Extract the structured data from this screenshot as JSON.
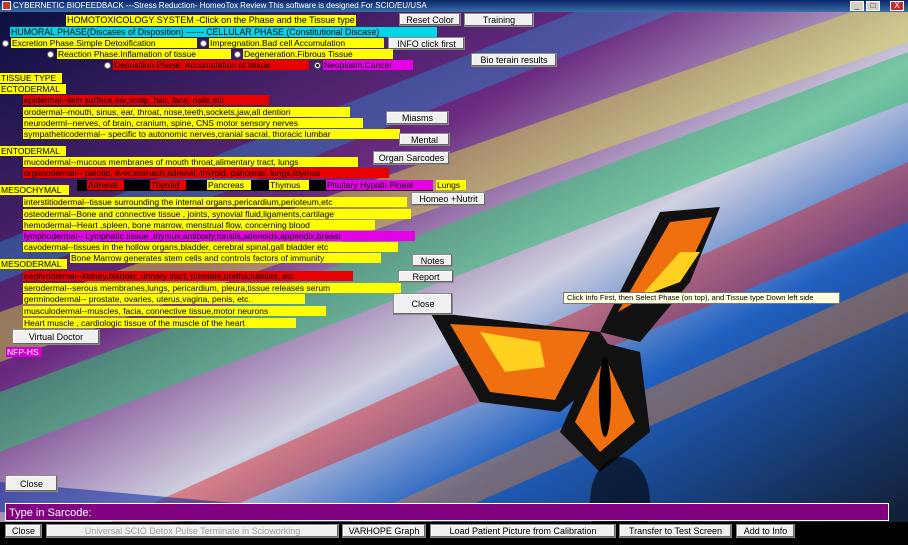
{
  "window": {
    "title": "CYBERNETIC BIOFEEDBACK    ---Stress Reduction-    HomeoTox Review    This software is designed For SCIO/EU/USA",
    "controls": [
      "_",
      "□",
      "X"
    ]
  },
  "header": {
    "system_title": "HOMOTOXICOLOGY SYSTEM  -Click on the Phase and the Tissue type",
    "reset_label": "Reset Color",
    "training_label": "Training",
    "phase_header": "HUMORAL PHASE(Discases of Disposition) ------ CELLULAR PHASE (Constitutional Discase)",
    "info_label": "INFO click first",
    "bio_terrain_label": "Bio terain results"
  },
  "phases": [
    {
      "label": "Excretion Phase.Simple Detoxification",
      "selected": false
    },
    {
      "label": "Impregnation.Bad cell Accumulation",
      "selected": false
    },
    {
      "label": "Reaction Phase.Inflamation of tissue",
      "selected": false
    },
    {
      "label": "Degeneration.Fibrous Tissue",
      "selected": false
    },
    {
      "label": "Deposition Phase. Accumulation of tissue",
      "selected": false
    },
    {
      "label": "Neoplasm.Cancer",
      "selected": true
    }
  ],
  "tissue": {
    "title": "TISSUE TYPE",
    "ectodermal": {
      "header": "ECTODERMAL",
      "items": [
        "epidermal--skin surface,ear,scalp, hair, face, nails,etc",
        "orodermal--mouth, sinus, ear, throat, nose,teeth,sockets,jaw,all dention",
        "neuroderml--nerves, of brain, cranium, spine, CNS motor sensory nerves",
        "sympatheticodermal-- specific to autonomic nerves,cranial sacral, thoracic lumbar"
      ]
    },
    "entodermal": {
      "header": "ENTODERMAL",
      "items": [
        "mucodermal--mucous membranes of mouth throat,alimentary tract, lungs",
        "organodermal-- parotid, liver,stomach,adrenal, thyroid, pancreas, lungs,thymus"
      ]
    },
    "organs": [
      "Adrenal",
      "Thyroid",
      "Pancreas",
      "Thymus",
      "Pituitary Hypoth Pineal",
      "Lungs"
    ],
    "mesochymal": {
      "header": "MESOCHYMAL",
      "items": [
        "interstitiodermal--tissue surrounding the internal organs,pericardium,perioteum,etc",
        "osteodermal--Bone and connective tissue , joints, synovial fluid,ligaments,cartilage",
        "hemodermal--Heart ,spleen, bone marrow, menstrual flow, concerning blood",
        "lymphodermal-- Lymphatic tissue ,thymus,antibody,tonsils,adenoids,appendix,breast",
        "cavodermal--tissues in the hollow organs,bladder, cerebral spinal,gall bladder etc",
        "Bone Marrow generates stem cells and controls factors of immunity"
      ]
    },
    "mesodermal": {
      "header": "MESODERMAL",
      "items": [
        "nephrodermal--kidney,bladder, urinary tract, prostate,uretha,tubules, etc",
        "serodermal--serous membranes,lungs, pericardium, pleura,tissue releases serum",
        "germinodermal-- prostate, ovaries, uterus,vagina, penis, etc.",
        "musculodermal--muscles, facia, connective tissue,motor neurons",
        "Heart muscle , cardiologic tissue of the muscle of the heart"
      ]
    }
  },
  "side_buttons": {
    "miasms": "Miasms",
    "mental": "Mental",
    "organ_sarcodes": "Organ Sarcodes",
    "homeo_nutrit": "Homeo +Nutrit",
    "notes": "Notes",
    "report": "Report",
    "close": "Close"
  },
  "virtual_doctor": "Virtual Doctor",
  "nfp": "NFP-HS",
  "tooltip": "Click Info First, then Select Phase (on top), and Tissue type Down left side",
  "close_left": "Close",
  "sarcode_input": "Type in Sarcode:",
  "bottom": {
    "close": "Close",
    "detox": "Universal SCIO Detox Pulse Terminate in Scioworking",
    "varhope": "VARHOPE Graph",
    "load_patient": "Load Patient Picture from Calibration",
    "transfer": "Transfer to Test Screen",
    "add_info": "Add to Info"
  },
  "colors": {
    "yellow": "#ffff00",
    "red": "#e60000",
    "magenta": "#e600e6",
    "cyan": "#00d8e8",
    "purple": "#800080"
  }
}
